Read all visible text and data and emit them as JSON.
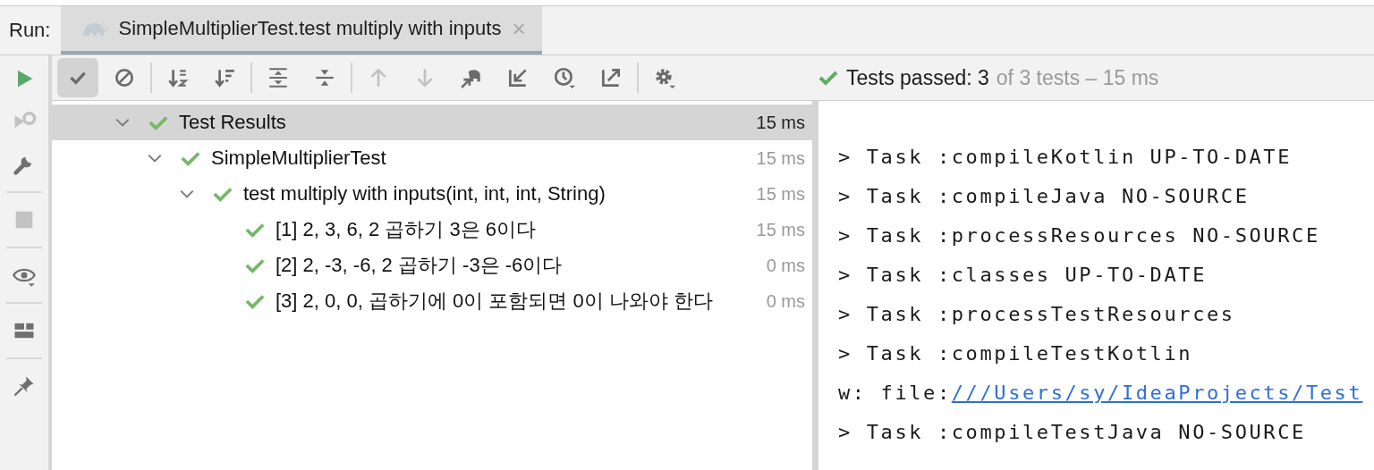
{
  "run_label": "Run:",
  "tab": {
    "title": "SimpleMultiplierTest.test multiply with inputs",
    "close": "×",
    "selected": true
  },
  "side_toolbar": [
    {
      "disabled": false
    },
    {
      "disabled": true
    },
    {
      "disabled": false
    },
    {
      "disabled": true
    },
    {
      "disabled": false
    },
    {
      "disabled": false
    },
    {
      "disabled": false
    }
  ],
  "toolbar": [
    {
      "selected": true,
      "disabled": false
    },
    {
      "selected": false,
      "disabled": false
    },
    {
      "selected": false,
      "disabled": false
    },
    {
      "selected": false,
      "disabled": false
    },
    {
      "selected": false,
      "disabled": false
    },
    {
      "selected": false,
      "disabled": false
    },
    {
      "selected": false,
      "disabled": true
    },
    {
      "selected": false,
      "disabled": true
    },
    {
      "selected": false,
      "disabled": false
    },
    {
      "selected": false,
      "disabled": false
    },
    {
      "selected": false,
      "disabled": false
    },
    {
      "selected": false,
      "disabled": false
    },
    {
      "selected": false,
      "disabled": false
    }
  ],
  "status": {
    "passed": true,
    "count": "Tests passed: 3",
    "rest": "of 3 tests – 15 ms"
  },
  "tree": [
    {
      "label": "Test Results",
      "duration": "15 ms",
      "selected": true,
      "expanded": true,
      "passed": true,
      "children": [
        {
          "label": "SimpleMultiplierTest",
          "duration": "15 ms",
          "selected": false,
          "expanded": true,
          "passed": true,
          "children": [
            {
              "label": "test multiply with inputs(int, int, int, String)",
              "duration": "15 ms",
              "selected": false,
              "expanded": true,
              "passed": true,
              "children": [
                {
                  "label": "[1] 2, 3, 6, 2 곱하기 3은 6이다",
                  "duration": "15 ms",
                  "selected": false,
                  "passed": true
                },
                {
                  "label": "[2] 2, -3, -6, 2 곱하기 -3은 -6이다",
                  "duration": "0 ms",
                  "selected": false,
                  "passed": true
                },
                {
                  "label": "[3] 2, 0, 0, 곱하기에 0이 포함되면 0이 나와야 한다",
                  "duration": "0 ms",
                  "selected": false,
                  "passed": true
                }
              ]
            }
          ]
        }
      ]
    }
  ],
  "console": [
    {
      "kind": "text",
      "text": "> Task :compileKotlin UP-TO-DATE"
    },
    {
      "kind": "text",
      "text": "> Task :compileJava NO-SOURCE"
    },
    {
      "kind": "text",
      "text": "> Task :processResources NO-SOURCE"
    },
    {
      "kind": "text",
      "text": "> Task :classes UP-TO-DATE"
    },
    {
      "kind": "text",
      "text": "> Task :processTestResources"
    },
    {
      "kind": "text",
      "text": "> Task :compileTestKotlin"
    },
    {
      "kind": "link",
      "text": "w: file:",
      "link": "///Users/sy/IdeaProjects/Test"
    },
    {
      "kind": "text",
      "text": "> Task :compileTestJava NO-SOURCE"
    }
  ]
}
